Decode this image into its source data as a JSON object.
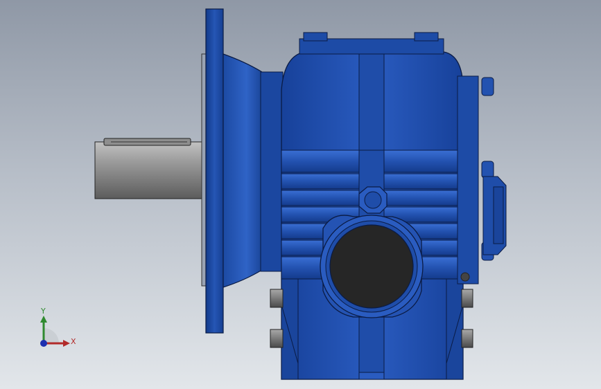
{
  "viewport": {
    "background_top": "#8f98a6",
    "background_bottom": "#e2e6ea"
  },
  "model": {
    "part": "worm-gear-reducer",
    "body_color": "#1f4fa8",
    "body_dark": "#0f2d70",
    "body_light": "#3b6fd0",
    "shaft_color": "#8a8a8a",
    "bore_color": "#262626"
  },
  "triad": {
    "x_label": "X",
    "y_label": "Y",
    "x_color": "#b22a2a",
    "y_color": "#2f8a2f",
    "z_color": "#1d2fb0"
  }
}
